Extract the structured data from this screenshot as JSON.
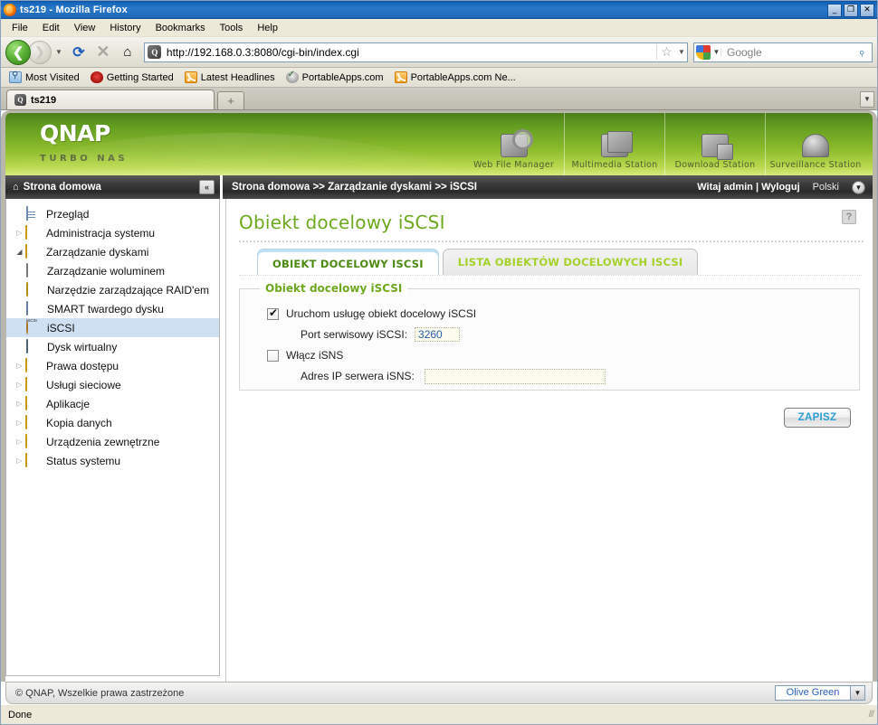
{
  "window": {
    "title": "ts219 - Mozilla Firefox",
    "minimize": "_",
    "maximize": "❐",
    "close": "✕"
  },
  "menu": [
    {
      "label": "File"
    },
    {
      "label": "Edit"
    },
    {
      "label": "View"
    },
    {
      "label": "History"
    },
    {
      "label": "Bookmarks"
    },
    {
      "label": "Tools"
    },
    {
      "label": "Help"
    }
  ],
  "nav": {
    "back_glyph": "❮",
    "forward_glyph": "❯",
    "history_caret": "▼",
    "reload_glyph": "⟳",
    "stop_glyph": "✕",
    "home_glyph": "⌂",
    "url": "http://192.168.0.3:8080/cgi-bin/index.cgi",
    "favicon_letter": "Q",
    "star_glyph": "☆",
    "star_caret": "▼",
    "search_placeholder": "Google",
    "search_caret": "▼",
    "search_glyph": "⌕"
  },
  "bookmarks": [
    {
      "label": "Most Visited",
      "icon": "folder-blue-icon"
    },
    {
      "label": "Getting Started",
      "icon": "firefox-started-icon"
    },
    {
      "label": "Latest Headlines",
      "icon": "rss-icon"
    },
    {
      "label": "PortableApps.com",
      "icon": "portableapps-icon"
    },
    {
      "label": "PortableApps.com Ne...",
      "icon": "rss-icon"
    }
  ],
  "tabs": {
    "items": [
      {
        "label": "ts219",
        "favicon_letter": "Q"
      }
    ],
    "new_tab_glyph": "+",
    "list_all_glyph": "▼"
  },
  "qnap": {
    "brand": "QNAP",
    "tagline": "TURBO NAS",
    "stations": [
      {
        "label": "Web File Manager",
        "icon": "web-file-manager-icon"
      },
      {
        "label": "Multimedia Station",
        "icon": "multimedia-station-icon"
      },
      {
        "label": "Download Station",
        "icon": "download-station-icon"
      },
      {
        "label": "Surveillance Station",
        "icon": "surveillance-station-icon"
      }
    ]
  },
  "sidebar": {
    "header": "Strona domowa",
    "header_icon": "home-icon",
    "collapse_glyph": "«",
    "items": [
      {
        "label": "Przegląd",
        "icon": "overview-icon",
        "arrow": "",
        "level": 0,
        "selected": false
      },
      {
        "label": "Administracja systemu",
        "icon": "folder-icon",
        "arrow": "▷",
        "level": 0,
        "selected": false
      },
      {
        "label": "Zarządzanie dyskami",
        "icon": "folder-open-icon",
        "arrow": "◢",
        "level": 0,
        "selected": false
      },
      {
        "label": "Zarządzanie woluminem",
        "icon": "volume-icon",
        "arrow": "",
        "level": 1,
        "selected": false
      },
      {
        "label": "Narzędzie zarządzające RAID'em",
        "icon": "raid-icon",
        "arrow": "",
        "level": 1,
        "selected": false
      },
      {
        "label": "SMART twardego dysku",
        "icon": "smart-icon",
        "arrow": "",
        "level": 1,
        "selected": false
      },
      {
        "label": "iSCSI",
        "icon": "iscsi-icon",
        "arrow": "",
        "level": 1,
        "selected": true
      },
      {
        "label": "Dysk wirtualny",
        "icon": "vdisk-icon",
        "arrow": "",
        "level": 1,
        "selected": false
      },
      {
        "label": "Prawa dostępu",
        "icon": "folder-icon",
        "arrow": "▷",
        "level": 0,
        "selected": false
      },
      {
        "label": "Usługi sieciowe",
        "icon": "folder-icon",
        "arrow": "▷",
        "level": 0,
        "selected": false
      },
      {
        "label": "Aplikacje",
        "icon": "folder-icon",
        "arrow": "▷",
        "level": 0,
        "selected": false
      },
      {
        "label": "Kopia danych",
        "icon": "folder-icon",
        "arrow": "▷",
        "level": 0,
        "selected": false
      },
      {
        "label": "Urządzenia zewnętrzne",
        "icon": "folder-icon",
        "arrow": "▷",
        "level": 0,
        "selected": false
      },
      {
        "label": "Status systemu",
        "icon": "folder-icon",
        "arrow": "▷",
        "level": 0,
        "selected": false
      }
    ]
  },
  "breadcrumb": {
    "text": "Strona domowa >> Zarządzanie dyskami >> iSCSI",
    "welcome": "Witaj admin | Wyloguj",
    "language": "Polski",
    "language_caret": "▼"
  },
  "main": {
    "page_title": "Obiekt docelowy iSCSI",
    "help_glyph": "?",
    "tabs": [
      {
        "label": "OBIEKT DOCELOWY ISCSI",
        "active": true
      },
      {
        "label": "LISTA OBIEKTÓW DOCELOWYCH ISCSI",
        "active": false
      }
    ],
    "fieldset_legend": "Obiekt docelowy iSCSI",
    "enable_service_label": "Uruchom usługę obiekt docelowy iSCSI",
    "enable_service_checked": true,
    "port_label": "Port serwisowy iSCSI:",
    "port_value": "3260",
    "isns_label": "Włącz iSNS",
    "isns_checked": false,
    "isns_ip_label": "Adres IP serwera iSNS:",
    "isns_ip_value": "",
    "save_label": "ZAPISZ"
  },
  "page_footer": {
    "copyright": "© QNAP, Wszelkie prawa zastrzeżone",
    "theme": "Olive Green",
    "theme_caret": "▼"
  },
  "statusbar": {
    "text": "Done",
    "grip": "///"
  },
  "colors": {
    "accent_green": "#6ea81e",
    "header_green": "#8cbb2c",
    "tab_active_blue": "#bfe2f5",
    "selection_blue": "#cfe0f2",
    "link_blue": "#2a5fb5"
  }
}
